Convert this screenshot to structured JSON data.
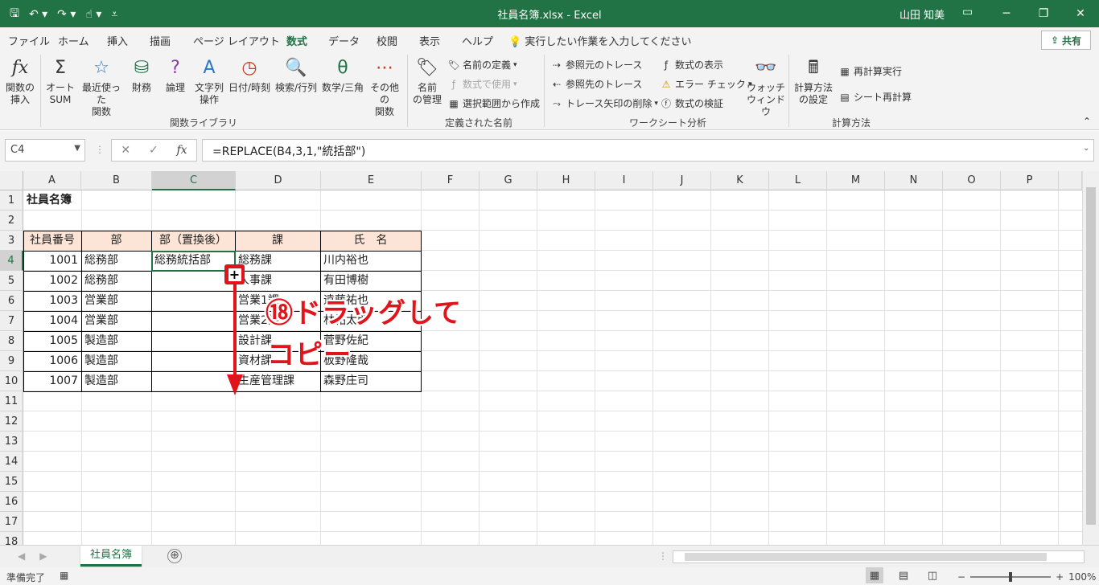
{
  "window": {
    "title": "社員名簿.xlsx  -  Excel",
    "user": "山田 知美",
    "qat_icons": [
      "save-icon",
      "undo-icon",
      "redo-icon",
      "touch-mode-icon",
      "customize-qat-icon"
    ]
  },
  "menu": {
    "tabs": [
      "ファイル",
      "ホーム",
      "挿入",
      "描画",
      "ページ レイアウト",
      "数式",
      "データ",
      "校閲",
      "表示",
      "ヘルプ"
    ],
    "active_tab": "数式",
    "tell_me": "実行したい作業を入力してください",
    "share": "共有"
  },
  "ribbon": {
    "library": {
      "insert_function": "関数の\n挿入",
      "autosum": "オート\nSUM",
      "recent": "最近使った\n関数",
      "financial": "財務",
      "logical": "論理",
      "text": "文字列\n操作",
      "datetime": "日付/時刻",
      "lookup": "検索/行列",
      "math": "数学/三角",
      "more": "その他の\n関数",
      "group": "関数ライブラリ"
    },
    "names": {
      "manager": "名前\nの管理",
      "define": "名前の定義",
      "use_in_formula": "数式で使用",
      "create_from_selection": "選択範囲から作成",
      "group": "定義された名前"
    },
    "audit": {
      "trace_precedents": "参照元のトレース",
      "trace_dependents": "参照先のトレース",
      "remove_arrows": "トレース矢印の削除",
      "show_formulas": "数式の表示",
      "error_check": "エラー チェック",
      "evaluate": "数式の検証",
      "watch": "ウォッチ\nウィンドウ",
      "group": "ワークシート分析"
    },
    "calc": {
      "options": "計算方法\nの設定",
      "calc_now": "再計算実行",
      "calc_sheet": "シート再計算",
      "group": "計算方法"
    }
  },
  "formula_bar": {
    "name_box": "C4",
    "formula": "=REPLACE(B4,3,1,\"統括部\")",
    "fx": "fx"
  },
  "columns": [
    "A",
    "B",
    "C",
    "D",
    "E",
    "F",
    "G",
    "H",
    "I",
    "J",
    "K",
    "L",
    "M",
    "N",
    "O",
    "P"
  ],
  "rows": [
    "1",
    "2",
    "3",
    "4",
    "5",
    "6",
    "7",
    "8",
    "9",
    "10",
    "11",
    "12",
    "13",
    "14",
    "15",
    "16",
    "17",
    "18"
  ],
  "sheet": {
    "title": "社員名簿",
    "headers": [
      "社員番号",
      "部",
      "部（置換後）",
      "課",
      "氏　名"
    ],
    "records": [
      {
        "id": "1001",
        "dept": "総務部",
        "replaced": "総務統括部",
        "section": "総務課",
        "name": "川内裕也"
      },
      {
        "id": "1002",
        "dept": "総務部",
        "replaced": "",
        "section": "人事課",
        "name": "有田博樹"
      },
      {
        "id": "1003",
        "dept": "営業部",
        "replaced": "",
        "section": "営業1課",
        "name": "遠藤祐也"
      },
      {
        "id": "1004",
        "dept": "営業部",
        "replaced": "",
        "section": "営業2課",
        "name": "林祐太郎"
      },
      {
        "id": "1005",
        "dept": "製造部",
        "replaced": "",
        "section": "設計課",
        "name": "菅野佐紀"
      },
      {
        "id": "1006",
        "dept": "製造部",
        "replaced": "",
        "section": "資材課",
        "name": "板野隆哉"
      },
      {
        "id": "1007",
        "dept": "製造部",
        "replaced": "",
        "section": "生産管理課",
        "name": "森野庄司"
      }
    ]
  },
  "annotation": {
    "line1": "⑱ドラッグして",
    "line2": "コピー",
    "color": "#e0141b"
  },
  "sheet_tabs": {
    "active": "社員名簿",
    "add": "⊕"
  },
  "status": {
    "ready": "準備完了",
    "zoom": "100%"
  },
  "colors": {
    "accent": "#217346",
    "header_fill": "#fce4d6"
  }
}
